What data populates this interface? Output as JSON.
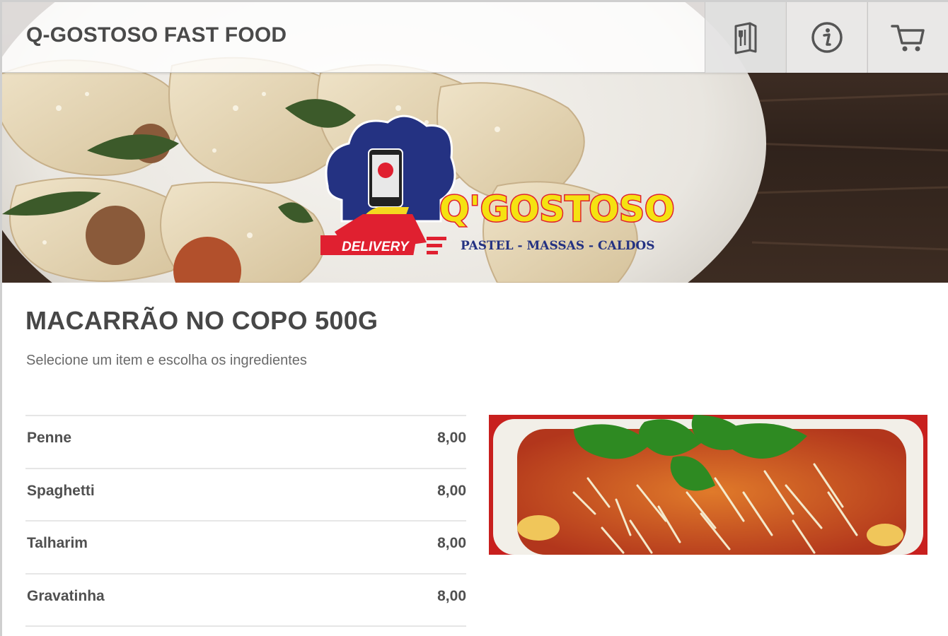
{
  "header": {
    "title": "Q-GOSTOSO FAST FOOD",
    "buttons": [
      {
        "name": "menu",
        "icon": "menu-book-icon"
      },
      {
        "name": "info",
        "icon": "info-icon"
      },
      {
        "name": "cart",
        "icon": "cart-icon"
      }
    ]
  },
  "logo": {
    "brand": "Q'GOSTOSO",
    "tagline": "PASTEL - MASSAS - CALDOS",
    "badge": "DELIVERY"
  },
  "category": {
    "title": "MACARRÃO NO COPO 500G",
    "subtitle": "Selecione um item e escolha os ingredientes"
  },
  "items": [
    {
      "name": "Penne",
      "price": "8,00"
    },
    {
      "name": "Spaghetti",
      "price": "8,00"
    },
    {
      "name": "Talharim",
      "price": "8,00"
    },
    {
      "name": "Gravatinha",
      "price": "8,00"
    }
  ],
  "colors": {
    "brand_yellow": "#f5e211",
    "brand_red": "#e02030",
    "brand_navy": "#1f2d7a",
    "text_dark": "#474747"
  }
}
